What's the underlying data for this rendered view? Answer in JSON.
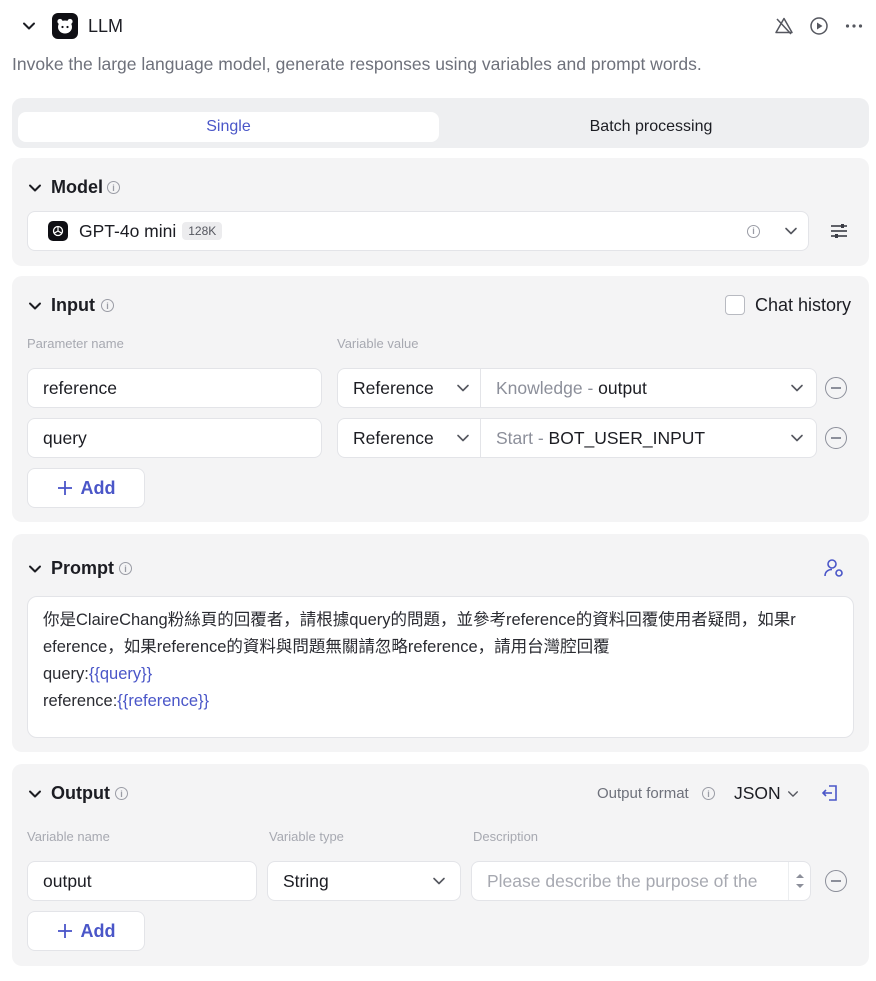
{
  "header": {
    "title": "LLM",
    "description": "Invoke the large language model, generate responses using variables and prompt words.",
    "icons": [
      "collapse-chevron-icon",
      "llm-logo-icon",
      "disable-alert-icon",
      "run-play-icon",
      "more-dots-icon"
    ]
  },
  "mode_tabs": {
    "single": "Single",
    "batch": "Batch processing",
    "active": "Single"
  },
  "model": {
    "section_title": "Model",
    "name": "GPT-4o mini",
    "context_badge": "128K"
  },
  "input": {
    "section_title": "Input",
    "chat_history_label": "Chat history",
    "chat_history_checked": false,
    "col_param": "Parameter name",
    "col_value": "Variable value",
    "rows": [
      {
        "name": "reference",
        "type": "Reference",
        "source": "Knowledge",
        "sep": " - ",
        "field": "output"
      },
      {
        "name": "query",
        "type": "Reference",
        "source": "Start",
        "sep": " - ",
        "field": "BOT_USER_INPUT"
      }
    ],
    "add_label": "Add"
  },
  "prompt": {
    "section_title": "Prompt",
    "line1": "你是ClaireChang粉絲頁的回覆者，請根據query的問題，並參考reference的資料回覆使用者疑問，如果r",
    "line2": "eference，如果reference的資料與問題無關請忽略reference，請用台灣腔回覆",
    "line3_prefix": "query:",
    "line3_var": "{{query}}",
    "line4_prefix": "reference:",
    "line4_var": "{{reference}}"
  },
  "output": {
    "section_title": "Output",
    "format_label": "Output format",
    "format_value": "JSON",
    "col_name": "Variable name",
    "col_type": "Variable type",
    "col_desc": "Description",
    "rows": [
      {
        "name": "output",
        "type": "String",
        "description_placeholder": "Please describe the purpose of the"
      }
    ],
    "add_label": "Add"
  },
  "colors": {
    "accent": "#4a56c8",
    "panel_bg": "#f4f4f5",
    "border": "#e3e4e8"
  }
}
